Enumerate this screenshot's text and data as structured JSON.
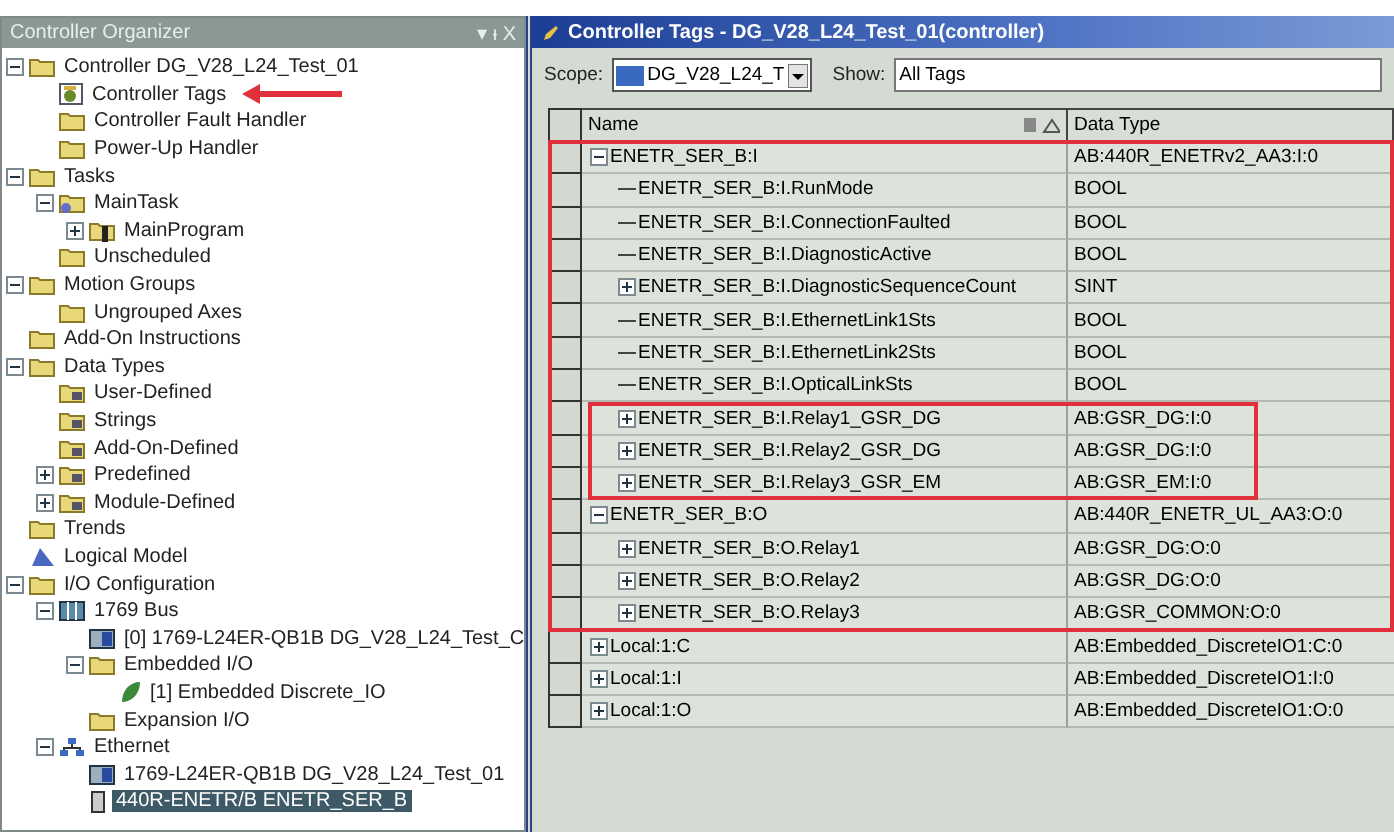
{
  "organizer": {
    "title": "Controller Organizer",
    "controls": "▾ ᵻ X",
    "tree": [
      {
        "label": "Controller DG_V28_L24_Test_01",
        "kind": "folder",
        "expanded": true,
        "children": [
          {
            "label": "Controller Tags",
            "kind": "tags",
            "arrow_pointer": true
          },
          {
            "label": "Controller Fault Handler",
            "kind": "folder"
          },
          {
            "label": "Power-Up Handler",
            "kind": "folder"
          }
        ]
      },
      {
        "label": "Tasks",
        "kind": "folder",
        "expanded": true,
        "children": [
          {
            "label": "MainTask",
            "kind": "task",
            "expanded": true,
            "children": [
              {
                "label": "MainProgram",
                "kind": "program",
                "expanded": false
              }
            ]
          },
          {
            "label": "Unscheduled",
            "kind": "folder"
          }
        ]
      },
      {
        "label": "Motion Groups",
        "kind": "folder",
        "expanded": true,
        "children": [
          {
            "label": "Ungrouped Axes",
            "kind": "folder"
          }
        ]
      },
      {
        "label": "Add-On Instructions",
        "kind": "folder"
      },
      {
        "label": "Data Types",
        "kind": "folder",
        "expanded": true,
        "children": [
          {
            "label": "User-Defined",
            "kind": "typefolder"
          },
          {
            "label": "Strings",
            "kind": "typefolder"
          },
          {
            "label": "Add-On-Defined",
            "kind": "typefolder"
          },
          {
            "label": "Predefined",
            "kind": "typefolder",
            "expanded": false
          },
          {
            "label": "Module-Defined",
            "kind": "typefolder",
            "expanded": false
          }
        ]
      },
      {
        "label": "Trends",
        "kind": "folder"
      },
      {
        "label": "Logical Model",
        "kind": "model"
      },
      {
        "label": "I/O Configuration",
        "kind": "folder",
        "expanded": true,
        "children": [
          {
            "label": "1769 Bus",
            "kind": "bus",
            "expanded": true,
            "children": [
              {
                "label": "[0] 1769-L24ER-QB1B DG_V28_L24_Test_C",
                "kind": "module"
              },
              {
                "label": "Embedded I/O",
                "kind": "folder",
                "expanded": true,
                "children": [
                  {
                    "label": "[1] Embedded Discrete_IO",
                    "kind": "leaf"
                  }
                ]
              },
              {
                "label": "Expansion I/O",
                "kind": "folder"
              }
            ]
          },
          {
            "label": "Ethernet",
            "kind": "network",
            "expanded": true,
            "children": [
              {
                "label": "1769-L24ER-QB1B DG_V28_L24_Test_01",
                "kind": "module"
              },
              {
                "label": "440R-ENETR/B ENETR_SER_B",
                "kind": "device",
                "selected": true
              }
            ]
          }
        ]
      }
    ]
  },
  "tags_window": {
    "title": "Controller Tags - DG_V28_L24_Test_01(controller)",
    "scope_label": "Scope:",
    "scope_value": "DG_V28_L24_T",
    "show_label": "Show:",
    "show_value": "All Tags",
    "columns": [
      "Name",
      "Data Type"
    ],
    "rows": [
      {
        "name": "ENETR_SER_B:I",
        "data_type": "AB:440R_ENETRv2_AA3:I:0",
        "expanded": true,
        "in_red_box": true,
        "children": [
          {
            "name": "ENETR_SER_B:I.RunMode",
            "data_type": "BOOL"
          },
          {
            "name": "ENETR_SER_B:I.ConnectionFaulted",
            "data_type": "BOOL"
          },
          {
            "name": "ENETR_SER_B:I.DiagnosticActive",
            "data_type": "BOOL"
          },
          {
            "name": "ENETR_SER_B:I.DiagnosticSequenceCount",
            "data_type": "SINT",
            "expanded": false
          },
          {
            "name": "ENETR_SER_B:I.EthernetLink1Sts",
            "data_type": "BOOL"
          },
          {
            "name": "ENETR_SER_B:I.EthernetLink2Sts",
            "data_type": "BOOL"
          },
          {
            "name": "ENETR_SER_B:I.OpticalLinkSts",
            "data_type": "BOOL"
          },
          {
            "name": "ENETR_SER_B:I.Relay1_GSR_DG",
            "data_type": "AB:GSR_DG:I:0",
            "expanded": false,
            "in_inner_red_box": true
          },
          {
            "name": "ENETR_SER_B:I.Relay2_GSR_DG",
            "data_type": "AB:GSR_DG:I:0",
            "expanded": false,
            "in_inner_red_box": true
          },
          {
            "name": "ENETR_SER_B:I.Relay3_GSR_EM",
            "data_type": "AB:GSR_EM:I:0",
            "expanded": false,
            "in_inner_red_box": true
          }
        ]
      },
      {
        "name": "ENETR_SER_B:O",
        "data_type": "AB:440R_ENETR_UL_AA3:O:0",
        "expanded": true,
        "in_red_box": true,
        "children": [
          {
            "name": "ENETR_SER_B:O.Relay1",
            "data_type": "AB:GSR_DG:O:0",
            "expanded": false
          },
          {
            "name": "ENETR_SER_B:O.Relay2",
            "data_type": "AB:GSR_DG:O:0",
            "expanded": false
          },
          {
            "name": "ENETR_SER_B:O.Relay3",
            "data_type": "AB:GSR_COMMON:O:0",
            "expanded": false
          }
        ]
      },
      {
        "name": "Local:1:C",
        "data_type": "AB:Embedded_DiscreteIO1:C:0",
        "expanded": false
      },
      {
        "name": "Local:1:I",
        "data_type": "AB:Embedded_DiscreteIO1:I:0",
        "expanded": false
      },
      {
        "name": "Local:1:O",
        "data_type": "AB:Embedded_DiscreteIO1:O:0",
        "expanded": false
      }
    ]
  }
}
